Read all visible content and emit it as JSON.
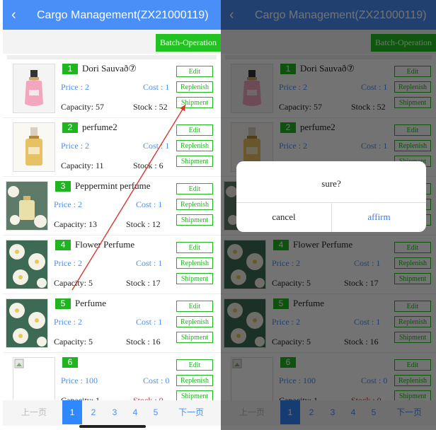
{
  "header": {
    "back_icon": "‹",
    "title": "Cargo Management(ZX21000119)"
  },
  "toolbar": {
    "batch_label": "Batch-Operation"
  },
  "buttons": {
    "edit": "Edit",
    "replenish": "Replenish",
    "shipment": "Shipment"
  },
  "items": [
    {
      "num": "1",
      "name": "Dori Sauvað⑦",
      "price": "Price : 2",
      "cost": "Cost : 1",
      "capacity": "Capacity:  57",
      "stock": "Stock :  52",
      "image": "pink-perfume-bottle"
    },
    {
      "num": "2",
      "name": "perfume2",
      "price": "Price : 2",
      "cost": "Cost : 1",
      "capacity": "Capacity:  11",
      "stock": "Stock :  6",
      "image": "gold-perfume-bottle"
    },
    {
      "num": "3",
      "name": "Peppermint perfume",
      "price": "Price : 2",
      "cost": "Cost : 1",
      "capacity": "Capacity:  13",
      "stock": "Stock :  12",
      "image": "perfume-with-flowers"
    },
    {
      "num": "4",
      "name": "Flower Perfume",
      "price": "Price : 2",
      "cost": "Cost : 1",
      "capacity": "Capacity:  5",
      "stock": "Stock :  17",
      "image": "white-flowers"
    },
    {
      "num": "5",
      "name": "Perfume",
      "price": "Price : 2",
      "cost": "Cost : 1",
      "capacity": "Capacity:  5",
      "stock": "Stock :  16",
      "image": "white-flowers"
    },
    {
      "num": "6",
      "name": "",
      "price": "Price : 100",
      "cost": "Cost : 0",
      "capacity": "Capacity:  1",
      "stock": "Stock :  0",
      "image": "broken-image"
    }
  ],
  "pagination": {
    "prev": "上一页",
    "pages": [
      "1",
      "2",
      "3",
      "4",
      "5"
    ],
    "active": "1",
    "next": "下一页"
  },
  "dialog": {
    "message": "sure?",
    "cancel": "cancel",
    "affirm": "affirm"
  },
  "colors": {
    "header": "#4a8ff7",
    "green": "#20b520",
    "link_blue": "#4a8ff7",
    "stock_zero": "#e02020",
    "annotation_arrow": "#d9352a"
  }
}
